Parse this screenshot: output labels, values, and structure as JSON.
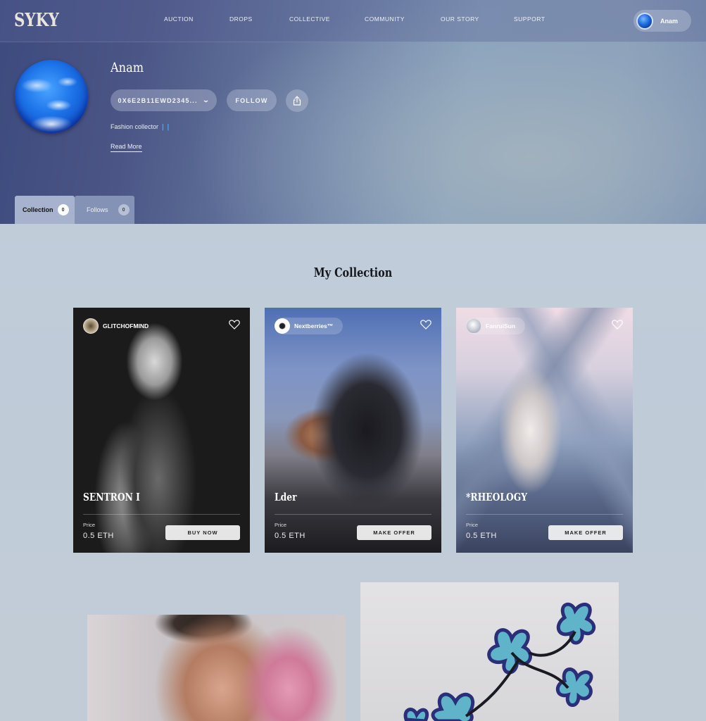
{
  "brand": {
    "logo": "SYKY"
  },
  "nav": {
    "links": [
      "AUCTION",
      "DROPS",
      "COLLECTIVE",
      "COMMUNITY",
      "OUR STORY",
      "SUPPORT"
    ],
    "user": {
      "name": "Anam",
      "avatar_icon": "globe-avatar"
    }
  },
  "profile": {
    "name": "Anam",
    "wallet_address": "0X6E2B11EWD2345...",
    "follow_label": "FOLLOW",
    "share_icon": "share-icon",
    "bio": "Fashion collector",
    "bio_emoji": "💧",
    "read_more": "Read More"
  },
  "tabs": [
    {
      "label": "Collection",
      "count": "0",
      "active": true
    },
    {
      "label": "Follows",
      "count": "0",
      "active": false
    }
  ],
  "collection": {
    "title": "My Collection",
    "price_label": "Price",
    "items": [
      {
        "creator": "GLITCHOFMIND",
        "title": "SENTRON I",
        "price": "0.5 ETH",
        "action": "BUY NOW"
      },
      {
        "creator": "Nextberries™",
        "title": "Lder",
        "price": "0.5 ETH",
        "action": "MAKE OFFER"
      },
      {
        "creator": "FanruiSun",
        "title": "*RHEOLOGY",
        "price": "0.5 ETH",
        "action": "MAKE OFFER"
      }
    ]
  },
  "colors": {
    "header_gradient_start": "#3d4a7d",
    "header_gradient_end": "#8ba1ba",
    "page_background": "#c4cfdb",
    "active_tab": "#a7b3ce",
    "inactive_tab": "#8492b6",
    "title_text": "#15161c",
    "accent_drop": "#3fb0ff"
  }
}
